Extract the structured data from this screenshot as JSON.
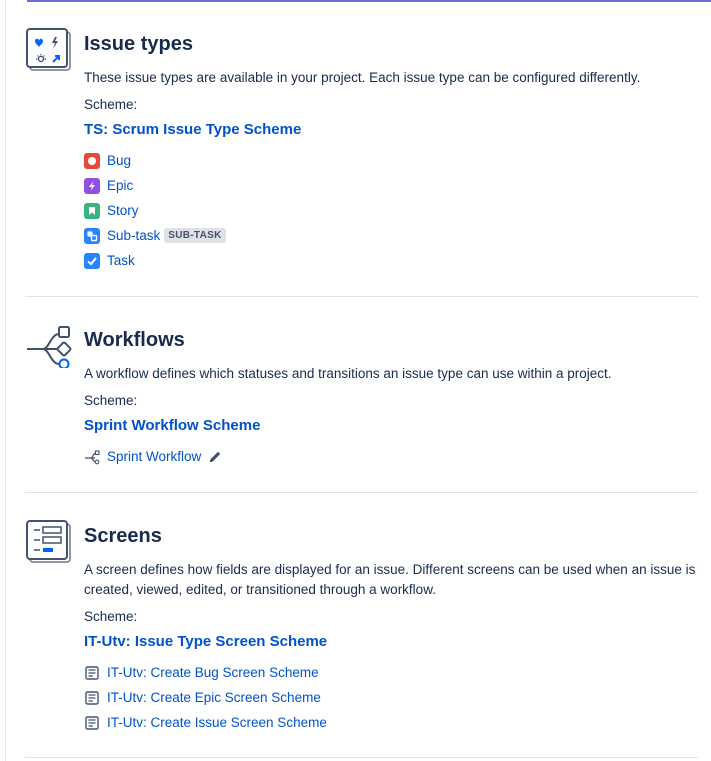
{
  "issue_types": {
    "title": "Issue types",
    "description": "These issue types are available in your project. Each issue type can be configured differently.",
    "scheme_label": "Scheme:",
    "scheme_name": "TS: Scrum Issue Type Scheme",
    "items": [
      {
        "label": "Bug",
        "icon": "bug-icon",
        "color": "#e5493a"
      },
      {
        "label": "Epic",
        "icon": "epic-icon",
        "color": "#904ee2"
      },
      {
        "label": "Story",
        "icon": "story-icon",
        "color": "#63ba3c"
      },
      {
        "label": "Sub-task",
        "icon": "subtask-icon",
        "color": "#4bade8",
        "badge": "SUB-TASK"
      },
      {
        "label": "Task",
        "icon": "task-icon",
        "color": "#4bade8"
      }
    ]
  },
  "workflows": {
    "title": "Workflows",
    "description": "A workflow defines which statuses and transitions an issue type can use within a project.",
    "scheme_label": "Scheme:",
    "scheme_name": "Sprint Workflow Scheme",
    "items": [
      {
        "label": "Sprint Workflow",
        "icon": "workflow-icon"
      }
    ]
  },
  "screens": {
    "title": "Screens",
    "description": "A screen defines how fields are displayed for an issue. Different screens can be used when an issue is created, viewed, edited, or transitioned through a workflow.",
    "scheme_label": "Scheme:",
    "scheme_name": "IT-Utv: Issue Type Screen Scheme",
    "items": [
      {
        "label": "IT-Utv: Create Bug Screen Scheme",
        "icon": "screen-scheme-icon"
      },
      {
        "label": "IT-Utv: Create Epic Screen Scheme",
        "icon": "screen-scheme-icon"
      },
      {
        "label": "IT-Utv: Create Issue Screen Scheme",
        "icon": "screen-scheme-icon"
      }
    ]
  },
  "colors": {
    "link": "#0052cc",
    "text": "#172b4d",
    "accent_line": "#6b6bd6"
  }
}
